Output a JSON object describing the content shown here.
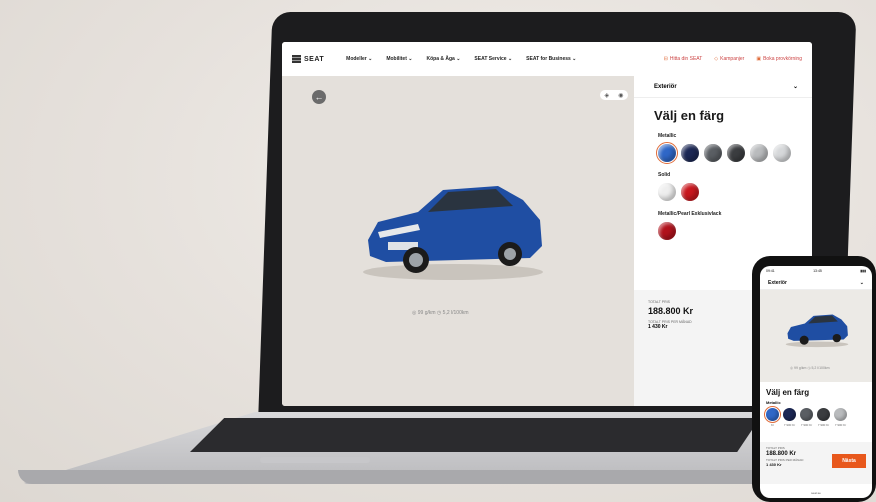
{
  "colors": {
    "accent": "#e8581c",
    "car_blue": "#1f4ea3"
  },
  "nav": {
    "brand": "SEAT",
    "items": [
      "Modeller",
      "Mobilitet",
      "Köpa & Äga",
      "SEAT Service",
      "SEAT for Business"
    ],
    "right": [
      {
        "icon": "car-icon",
        "label": "Hitta din SEAT"
      },
      {
        "icon": "tag-icon",
        "label": "Kampanjer"
      },
      {
        "icon": "calendar-icon",
        "label": "Boka provkörning"
      }
    ]
  },
  "stage": {
    "info": "◎ 99 g/km  ◷ 5,2 l/100km"
  },
  "panel": {
    "section": "Exteriör",
    "title": "Välj en färg",
    "groups": [
      {
        "label": "Metallic",
        "colors": [
          "#2f67c7",
          "#1b2754",
          "#5a5e63",
          "#3b3d40",
          "#b9bbbd",
          "#d6d8da"
        ],
        "selected": 0
      },
      {
        "label": "Solid",
        "colors": [
          "#eeeeee",
          "#c8171e"
        ]
      },
      {
        "label": "Metallic/Pearl Exklusivlack",
        "colors": [
          "#b1121c"
        ]
      }
    ],
    "price_label": "TOTALT PRIS",
    "price": "188.800 Kr",
    "monthly_label": "TOTALT PRIS PER MÅNAD",
    "monthly": "1 430 Kr"
  },
  "phone": {
    "status_left": "09:41",
    "status_center": "13:45",
    "status_right": "▮▮▮",
    "section": "Exteriör",
    "info": "◎ 99 g/km  ◷ 5,2 l/100km",
    "title": "Välj en färg",
    "group": "Metallic",
    "colors": [
      "#2f67c7",
      "#1b2754",
      "#5a5e63",
      "#3b3d40",
      "#b9bbbd"
    ],
    "prices": [
      "Kr",
      "7 900 Kr",
      "7 900 Kr",
      "7 900 Kr",
      "7 900 Kr"
    ],
    "price_label": "TOTALT PRIS",
    "price": "188.800 Kr",
    "monthly_label": "TOTALT PRIS PER MÅNAD",
    "monthly": "1 430 Kr",
    "next": "Nästa",
    "url": "seat.se"
  }
}
